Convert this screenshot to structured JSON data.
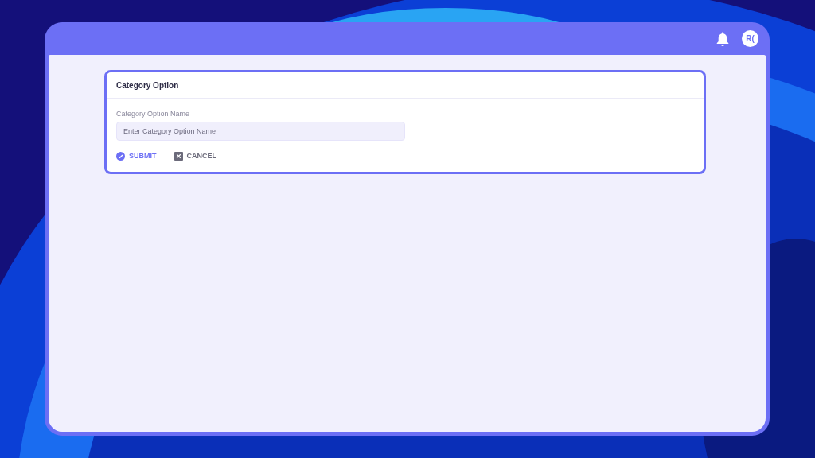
{
  "header": {
    "avatar": "R("
  },
  "card": {
    "title": "Category Option",
    "field": {
      "label": "Category Option Name",
      "placeholder": "Enter Category Option Name"
    },
    "actions": [
      {
        "kind": "submit",
        "label": "SUBMIT"
      },
      {
        "kind": "cancel",
        "label": "CANCEL"
      }
    ]
  }
}
